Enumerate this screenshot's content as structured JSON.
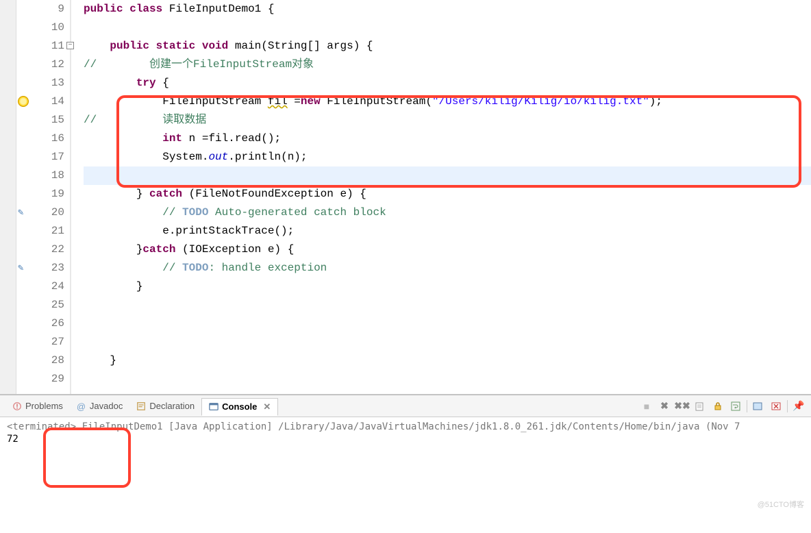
{
  "code": {
    "lines": [
      {
        "n": 9,
        "marker": null,
        "fold": null
      },
      {
        "n": 10,
        "marker": null,
        "fold": null
      },
      {
        "n": 11,
        "marker": null,
        "fold": "minus"
      },
      {
        "n": 12,
        "marker": null,
        "fold": null
      },
      {
        "n": 13,
        "marker": null,
        "fold": null
      },
      {
        "n": 14,
        "marker": "warn",
        "fold": null
      },
      {
        "n": 15,
        "marker": null,
        "fold": null
      },
      {
        "n": 16,
        "marker": null,
        "fold": null
      },
      {
        "n": 17,
        "marker": null,
        "fold": null
      },
      {
        "n": 18,
        "marker": null,
        "fold": null,
        "highlight": true
      },
      {
        "n": 19,
        "marker": null,
        "fold": null
      },
      {
        "n": 20,
        "marker": "task",
        "fold": null
      },
      {
        "n": 21,
        "marker": null,
        "fold": null
      },
      {
        "n": 22,
        "marker": null,
        "fold": null
      },
      {
        "n": 23,
        "marker": "task",
        "fold": null
      },
      {
        "n": 24,
        "marker": null,
        "fold": null
      },
      {
        "n": 25,
        "marker": null,
        "fold": null
      },
      {
        "n": 26,
        "marker": null,
        "fold": null
      },
      {
        "n": 27,
        "marker": null,
        "fold": null
      },
      {
        "n": 28,
        "marker": null,
        "fold": null
      },
      {
        "n": 29,
        "marker": null,
        "fold": null
      }
    ],
    "tokens": {
      "public": "public",
      "class": "class",
      "className": "FileInputDemo1",
      "static": "static",
      "void": "void",
      "main": "main",
      "argsType": "String[]",
      "argsName": "args",
      "comment1": "创建一个FileInputStream对象",
      "try": "try",
      "fisType": "FileInputStream",
      "fisVar": "fil",
      "new": "new",
      "path": "\"/Users/kilig/Kilig/io/kilig.txt\"",
      "comment2": "读取数据",
      "int": "int",
      "nVar": "n",
      "readCall": "fil.read()",
      "sys": "System",
      "out": "out",
      "println": "println",
      "catch": "catch",
      "exc1": "FileNotFoundException",
      "excVar": "e",
      "todo1a": "TODO",
      "todo1b": " Auto-generated catch block",
      "stackTrace": "e.printStackTrace();",
      "exc2": "IOException",
      "todo2a": "TODO",
      "todo2b": ": handle exception"
    }
  },
  "tabs": {
    "problems": "Problems",
    "javadoc": "Javadoc",
    "declaration": "Declaration",
    "console": "Console"
  },
  "console": {
    "terminated": "<terminated>",
    "status": " FileInputDemo1 [Java Application] /Library/Java/JavaVirtualMachines/jdk1.8.0_261.jdk/Contents/Home/bin/java  (Nov 7",
    "output": "72"
  },
  "watermark": "@51CTO博客"
}
